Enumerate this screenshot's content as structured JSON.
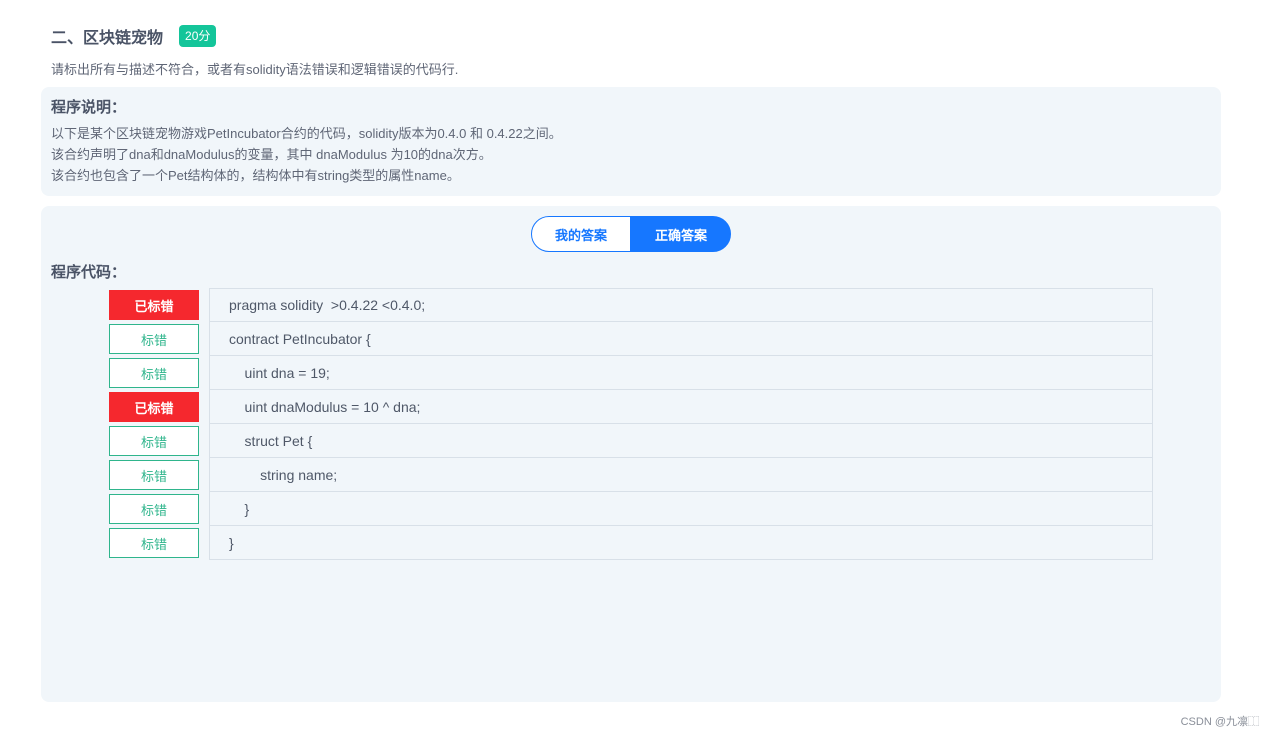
{
  "question": {
    "title": "二、区块链宠物",
    "score_badge": "20分",
    "description": "请标出所有与描述不符合，或者有solidity语法错误和逻辑错误的代码行."
  },
  "explanation": {
    "title": "程序说明：",
    "lines": [
      "以下是某个区块链宠物游戏PetIncubator合约的代码，solidity版本为0.4.0 和 0.4.22之间。",
      "该合约声明了dna和dnaModulus的变量，其中 dnaModulus 为10的dna次方。",
      "该合约也包含了一个Pet结构体的，结构体中有string类型的属性name。"
    ]
  },
  "answer_tabs": {
    "mine": "我的答案",
    "correct": "正确答案",
    "active": "correct"
  },
  "code_section": {
    "title": "程序代码："
  },
  "code_lines": [
    {
      "mark_label": "已标错",
      "marked": true,
      "code": "pragma solidity  >0.4.22 <0.4.0;"
    },
    {
      "mark_label": "标错",
      "marked": false,
      "code": "contract PetIncubator {"
    },
    {
      "mark_label": "标错",
      "marked": false,
      "code": "    uint dna = 19;"
    },
    {
      "mark_label": "已标错",
      "marked": true,
      "code": "    uint dnaModulus = 10 ^ dna;"
    },
    {
      "mark_label": "标错",
      "marked": false,
      "code": "    struct Pet {"
    },
    {
      "mark_label": "标错",
      "marked": false,
      "code": "        string name;"
    },
    {
      "mark_label": "标错",
      "marked": false,
      "code": "    }"
    },
    {
      "mark_label": "标错",
      "marked": false,
      "code": "}"
    }
  ],
  "footer": {
    "credit": "CSDN @九凛⿰"
  },
  "colors": {
    "accent_blue": "#1677ff",
    "marked_red": "#f5282e",
    "mark_green": "#2fb58c",
    "badge_green": "#14c59a",
    "panel_bg": "#f1f6fa"
  }
}
